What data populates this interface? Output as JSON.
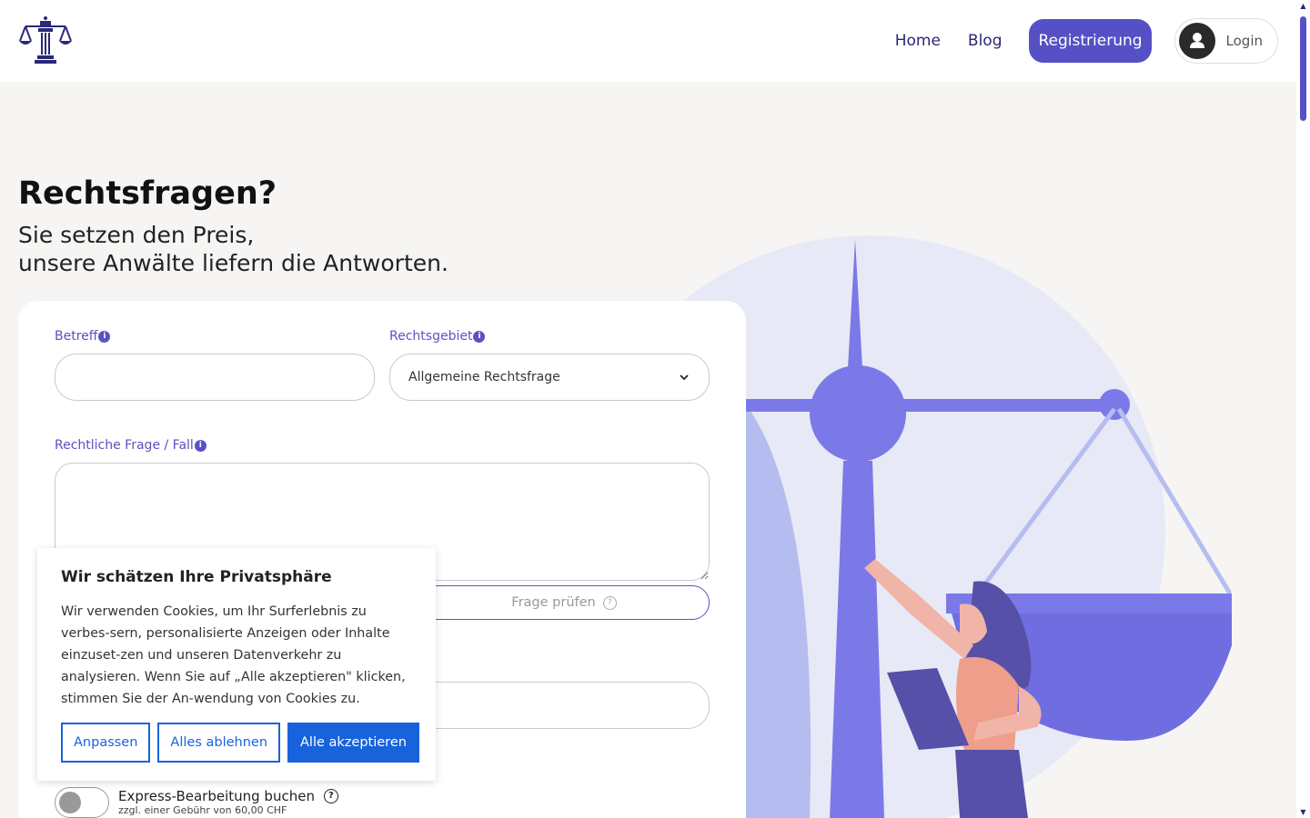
{
  "nav": {
    "home": "Home",
    "blog": "Blog",
    "register": "Registrierung",
    "login": "Login"
  },
  "hero": {
    "title": "Rechtsfragen?",
    "subtitle_line1": "Sie setzen den Preis,",
    "subtitle_line2": "unsere Anwälte liefern die Antworten."
  },
  "form": {
    "subject_label": "Betreff",
    "subject_value": "",
    "area_label": "Rechtsgebiet",
    "area_selected": "Allgemeine Rechtsfrage",
    "question_label": "Rechtliche Frage / Fall",
    "question_value": "",
    "check_button": "Frage prüfen",
    "express_label": "Express-Bearbeitung buchen",
    "express_fee": "zzgl. einer Gebühr von 60,00 CHF",
    "express_enabled": false
  },
  "cookie": {
    "title": "Wir schätzen Ihre Privatsphäre",
    "text": "Wir verwenden Cookies, um Ihr Surferlebnis zu verbes-sern, personalisierte Anzeigen oder Inhalte einzuset-zen und unseren Datenverkehr zu analysieren. Wenn Sie auf „Alle akzeptieren\" klicken, stimmen Sie der An-wendung von Cookies zu.",
    "customize": "Anpassen",
    "reject": "Alles ablehnen",
    "accept": "Alle akzeptieren"
  },
  "colors": {
    "brand": "#5650c6",
    "cookie_blue": "#1863dc",
    "illustration_primary": "#7b79e8",
    "illustration_bg": "#e8e9f6"
  }
}
